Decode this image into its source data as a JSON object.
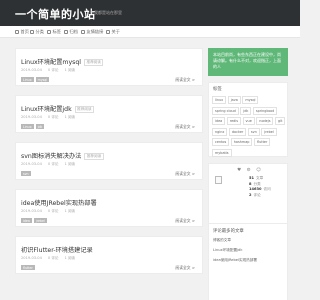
{
  "header": {
    "title": "一个简单的小站",
    "subtitle": "你我都是站在那里"
  },
  "nav": {
    "items": [
      {
        "label": "首页",
        "icon": "home-icon"
      },
      {
        "label": "分类",
        "icon": "folder-icon"
      },
      {
        "label": "标签",
        "icon": "tag-icon"
      },
      {
        "label": "归档",
        "icon": "archive-icon"
      },
      {
        "label": "友情链接",
        "icon": "link-icon"
      },
      {
        "label": "关于",
        "icon": "user-icon"
      }
    ]
  },
  "posts": [
    {
      "title": "Linux环境配置mysql",
      "badge": "推荐阅读",
      "meta": [
        "2019-03-04",
        "0 评论",
        "1 阅读"
      ],
      "more": "阅读全文 >",
      "tags": [
        "Linux",
        "mysql"
      ]
    },
    {
      "title": "Linux环境配置jdk",
      "badge": "推荐阅读",
      "meta": [
        "2019-03-04",
        "0 评论",
        "1 阅读"
      ],
      "more": "阅读全文 >",
      "tags": [
        "Linux",
        "jdk"
      ]
    },
    {
      "title": "svn图标消失解决办法",
      "badge": "推荐阅读",
      "meta": [
        "2019-03-04",
        "0 评论",
        "1 阅读"
      ],
      "more": "阅读全文 >",
      "tags": [
        "svn"
      ]
    },
    {
      "title": "idea使用JRebel实现热部署",
      "badge": "",
      "meta": [
        "2019-03-04",
        "0 评论",
        "1 阅读"
      ],
      "more": "阅读全文 >",
      "tags": [
        "idea",
        "jrebel"
      ]
    },
    {
      "title": "初识Flutter-环境搭建记录",
      "badge": "",
      "meta": [
        "2019-03-04",
        "0 评论",
        "1 阅读"
      ],
      "more": "阅读全文 >",
      "tags": [
        "flutter"
      ]
    }
  ],
  "sidebar": {
    "welcome": "本站目前尚，有些东西正在建设中，尚请谅解。有什么不对，欢迎指正，上面的人",
    "tags_title": "标签",
    "tags": [
      "linux",
      "java",
      "mysql",
      "spring cloud",
      "jdk",
      "springboot",
      "idea",
      "redis",
      "vue",
      "nodejs",
      "git",
      "nginx",
      "docker",
      "svn",
      "jrebel",
      "centos",
      "hashmap",
      "flutter",
      "mybatis"
    ],
    "social": [
      "♥",
      "⚙",
      "☺"
    ],
    "stats": [
      {
        "num": "51",
        "label": "文章"
      },
      {
        "num": "8",
        "label": "分类"
      },
      {
        "num": "14630",
        "label": "访问"
      },
      {
        "num": "2",
        "label": "评论"
      }
    ],
    "recent_title": "评论最多的文章",
    "recent": [
      "博客的文章",
      "Linux环境配置jdk",
      "idea使用JRebel实现热部署"
    ]
  },
  "colors": {
    "header_bg": "#2e3133",
    "accent": "#5fb878"
  }
}
